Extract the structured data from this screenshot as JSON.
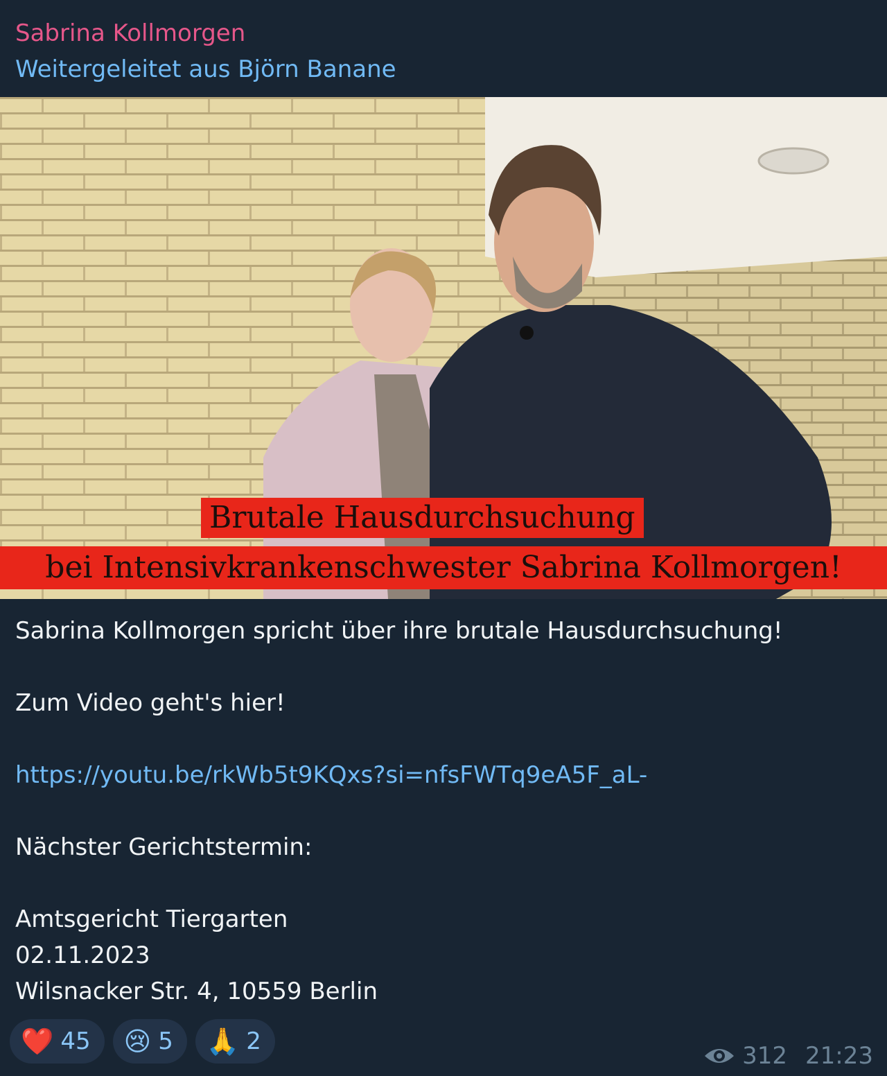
{
  "post": {
    "sender": "Sabrina Kollmorgen",
    "forwarded_from": "Weitergeleitet aus Björn Banane",
    "media": {
      "caption_line_1": "Brutale Hausdurchsuchung",
      "caption_line_2": "bei Intensivkrankenschwester Sabrina Kollmorgen!"
    },
    "text_lines": [
      "Sabrina Kollmorgen spricht über ihre brutale Hausdurchsuchung!",
      "",
      "Zum Video geht's hier!",
      "",
      "https://youtu.be/rkWb5t9KQxs?si=nfsFWTq9eA5F_aL-",
      "",
      "Nächster Gerichtstermin:",
      "",
      "Amtsgericht Tiergarten",
      "02.11.2023",
      "Wilsnacker Str. 4, 10559 Berlin"
    ],
    "reactions": [
      {
        "emoji": "❤️",
        "count": "45"
      },
      {
        "emoji": "😢",
        "count": "5"
      },
      {
        "emoji": "🙏",
        "count": "2"
      }
    ],
    "views": "312",
    "time": "21:23",
    "icons": {
      "views": "eye-icon"
    },
    "colors": {
      "sender": "#e6578a",
      "link": "#71baf5",
      "caption_bg": "#e8261a",
      "background": "#182533"
    }
  }
}
